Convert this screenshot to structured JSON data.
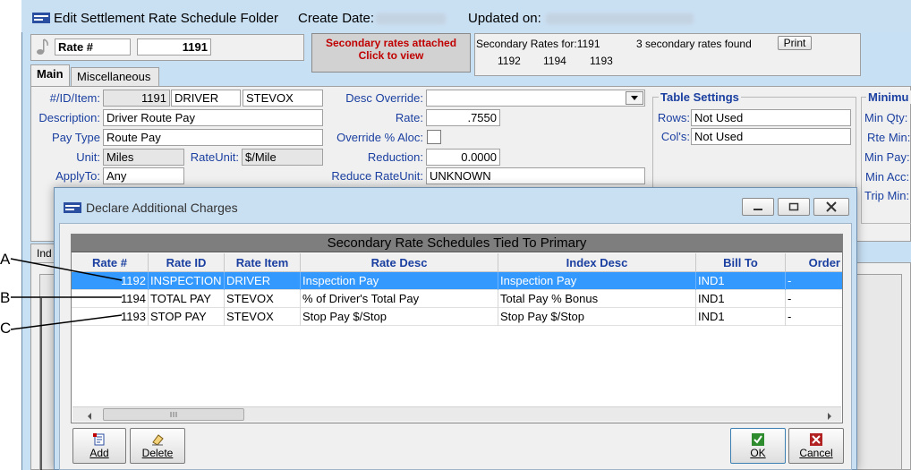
{
  "window": {
    "title": "Edit Settlement Rate Schedule Folder",
    "create_date_label": "Create Date:",
    "updated_on_label": "Updated on:"
  },
  "header": {
    "rate_label": "Rate #",
    "rate_number": "1191",
    "secondary_notice_line1": "Secondary rates attached",
    "secondary_notice_line2": "Click to view",
    "secondary_for_label": "Secondary Rates for:1191",
    "secondary_found": "3 secondary rates found",
    "print_button": "Print",
    "secondary_ids": [
      "1192",
      "1194",
      "1193"
    ]
  },
  "tabs": [
    "Main",
    "Miscellaneous"
  ],
  "lower_tab_fragment": "Ind",
  "form": {
    "id_item_label": "#/ID/Item:",
    "id_value": "1191",
    "id_code": "DRIVER",
    "id_item": "STEVOX",
    "description_label": "Description:",
    "description_value": "Driver Route Pay",
    "pay_type_label": "Pay Type",
    "pay_type_value": "Route Pay",
    "unit_label": "Unit:",
    "unit_value": "Miles",
    "rate_unit_label": "RateUnit:",
    "rate_unit_value": "$/Mile",
    "apply_to_label": "ApplyTo:",
    "apply_to_value": "Any",
    "desc_override_label": "Desc Override:",
    "rate_label": "Rate:",
    "rate_value": ".7550",
    "override_aloc_label": "Override % Aloc:",
    "reduction_label": "Reduction:",
    "reduction_value": "0.0000",
    "reduce_rate_unit_label": "Reduce RateUnit:",
    "reduce_rate_unit_value": "UNKNOWN"
  },
  "table_settings": {
    "title": "Table Settings",
    "rows_label": "Rows:",
    "rows_value": "Not Used",
    "cols_label": "Col's:",
    "cols_value": "Not Used"
  },
  "minimum": {
    "title": "Minimu",
    "labels": [
      "Min Qty:",
      "Rte Min:",
      "Min Pay:",
      "Min Acc:",
      "Trip Min:"
    ]
  },
  "dialog": {
    "title": "Declare Additional Charges",
    "grid_caption": "Secondary Rate Schedules Tied To Primary",
    "columns": [
      "Rate #",
      "Rate ID",
      "Rate Item",
      "Rate Desc",
      "Index Desc",
      "Bill To",
      "Order"
    ],
    "rows": [
      [
        "1192",
        "INSPECTION",
        "DRIVER",
        "Inspection Pay",
        "Inspection Pay",
        "IND1",
        "-"
      ],
      [
        "1194",
        "TOTAL PAY",
        "STEVOX",
        "% of Driver's Total Pay",
        "Total Pay % Bonus",
        "IND1",
        "-"
      ],
      [
        "1193",
        "STOP PAY",
        "STEVOX",
        "Stop Pay $/Stop",
        "Stop Pay $/Stop",
        "IND1",
        "-"
      ]
    ],
    "buttons": {
      "add": "Add",
      "delete": "Delete",
      "ok": "OK",
      "cancel": "Cancel"
    }
  },
  "callouts": [
    "A",
    "B",
    "C"
  ],
  "colors": {
    "selection": "#3399ff",
    "label_blue": "#1a3fa0",
    "notice_red": "#c00000",
    "window_bg": "#c8e0f4"
  }
}
